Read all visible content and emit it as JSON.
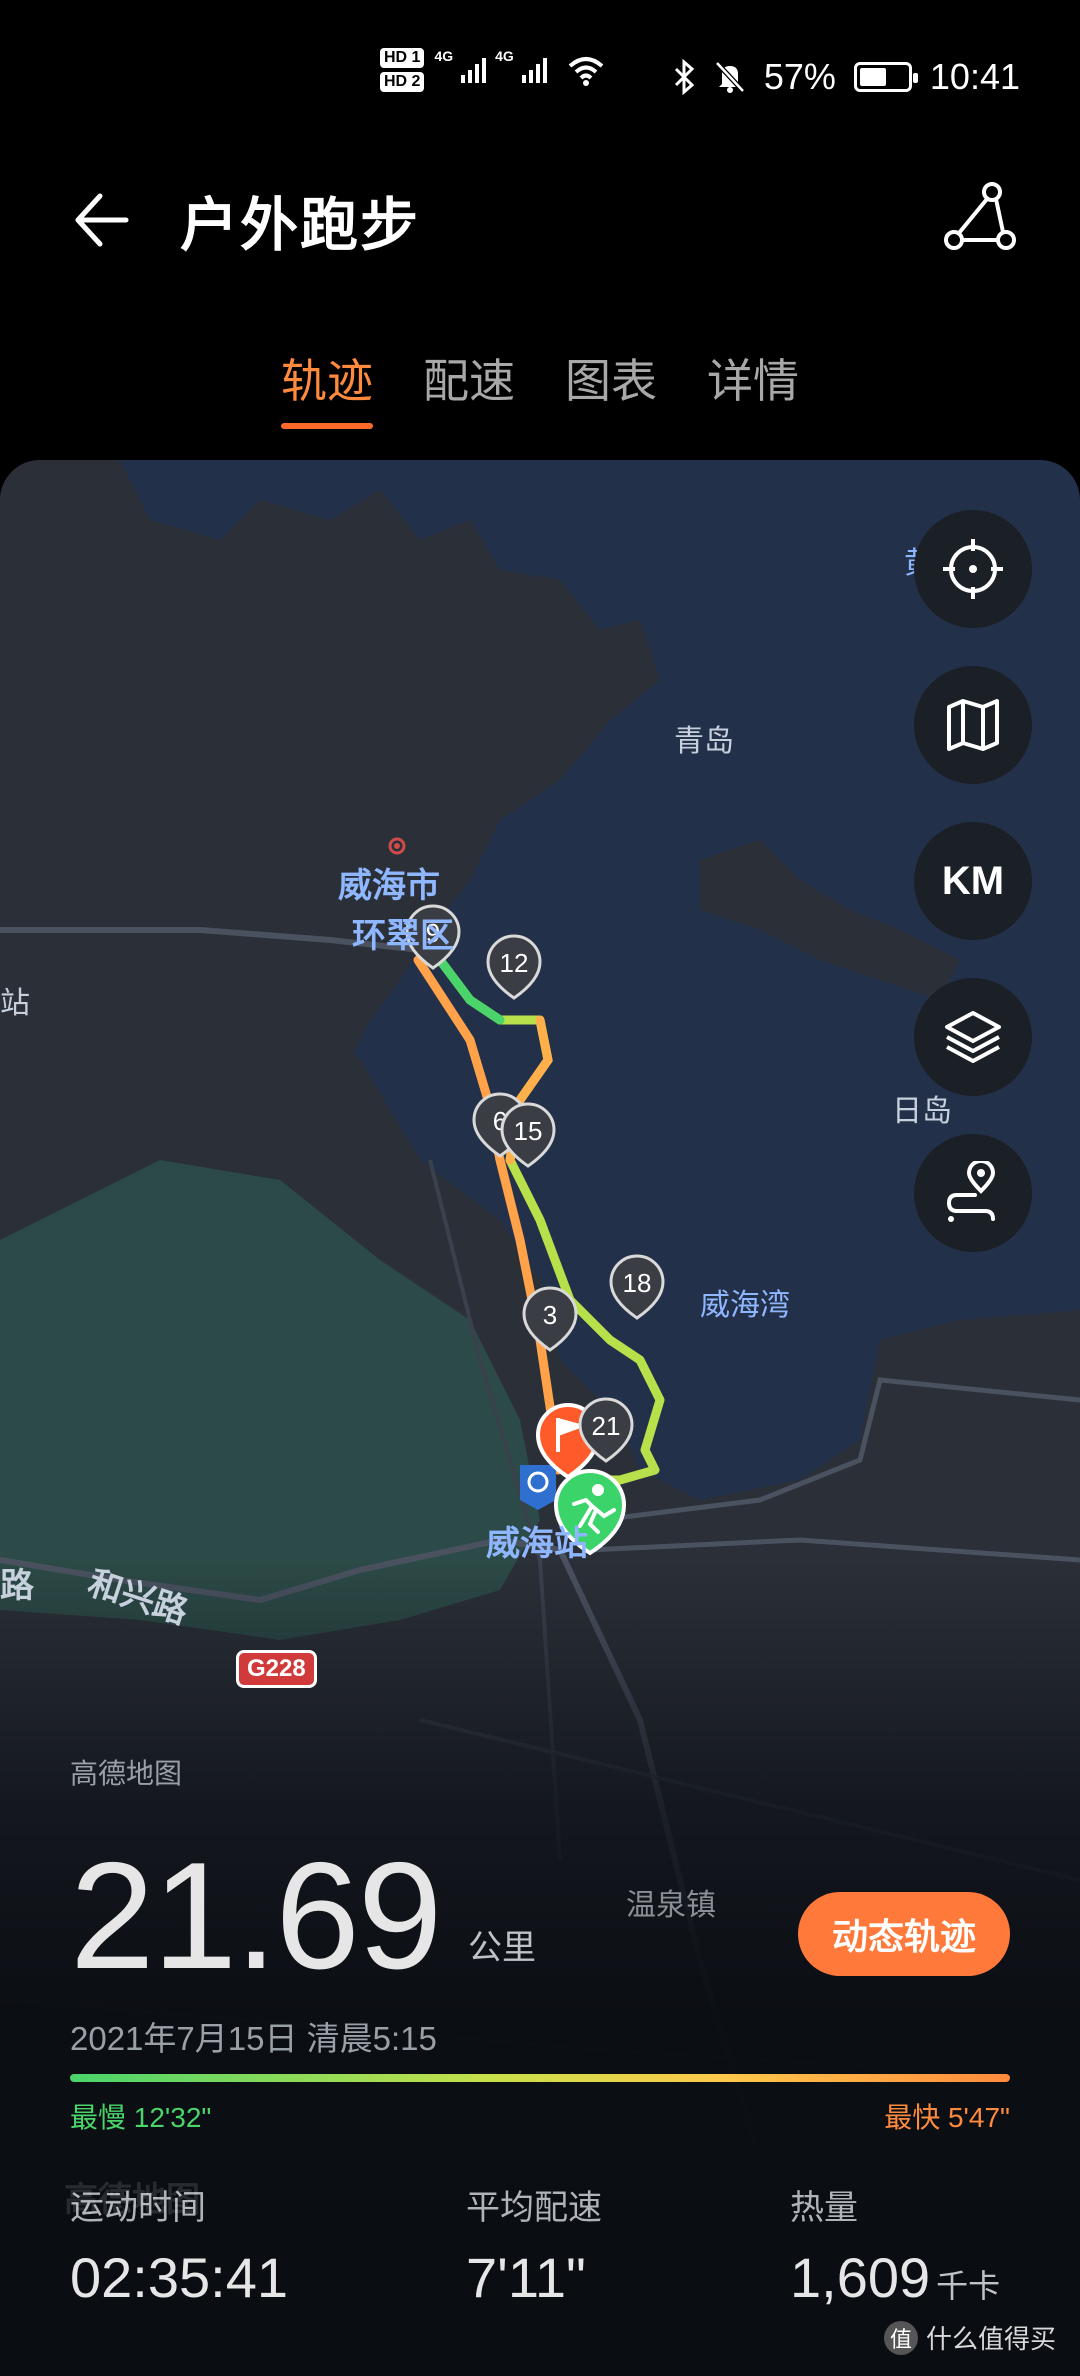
{
  "status_bar": {
    "sim1": "HD 1",
    "sim2": "HD 2",
    "network1": "4G",
    "network2": "4G",
    "battery": "57%",
    "battery_level": 0.57,
    "time": "10:41"
  },
  "header": {
    "title": "户外跑步",
    "back_icon": "arrow-left-icon",
    "share_icon": "share-icon"
  },
  "tabs": [
    {
      "label": "轨迹",
      "active": true
    },
    {
      "label": "配速",
      "active": false
    },
    {
      "label": "图表",
      "active": false
    },
    {
      "label": "详情",
      "active": false
    }
  ],
  "map": {
    "labels": {
      "weihai_city": "威海市",
      "huancui": "环翠区",
      "qingdao": "青岛",
      "huanghai": "黄海",
      "ridao": "日岛",
      "weihaiwan": "威海湾",
      "weihai_station": "威海站",
      "station_left": "站",
      "hexing_road": "和兴路",
      "road_left": "路",
      "wenquan": "温泉镇",
      "road_code": "G228"
    },
    "controls": [
      "locate-icon",
      "map-icon",
      "KM",
      "layers-icon",
      "route-icon"
    ],
    "km_markers": [
      "9",
      "12",
      "6",
      "15",
      "3",
      "18",
      "21"
    ],
    "provider": "高德地图",
    "provider_logo": "高德地图",
    "route_colors": {
      "slow": "#4ad46a",
      "mid": "#e0d84a",
      "fast": "#ff8a3d"
    }
  },
  "summary": {
    "distance": "21.69",
    "distance_unit": "公里",
    "dynamic_button": "动态轨迹",
    "datetime": "2021年7月15日 清晨5:15",
    "slowest": "最慢 12'32\"",
    "fastest": "最快 5'47\""
  },
  "stats": {
    "duration_label": "运动时间",
    "duration_value": "02:35:41",
    "pace_label": "平均配速",
    "pace_value": "7'11\"",
    "calories_label": "热量",
    "calories_value": "1,609",
    "calories_unit": "千卡"
  },
  "watermark": "什么值得买"
}
